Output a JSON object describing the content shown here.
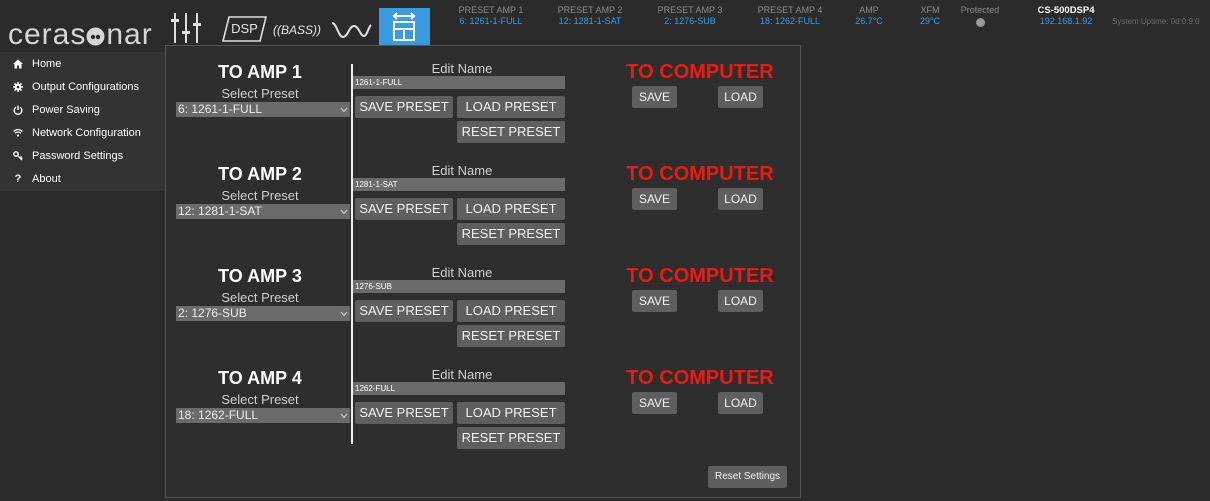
{
  "brand": {
    "logo_left": "ceras",
    "logo_right": "nar"
  },
  "toolbar": {
    "sliders_icon": "sliders-icon",
    "dsp_label": "DSP",
    "bass_label": "((BASS))",
    "wave_icon": "waveform-icon",
    "active_icon": "preset-transfer-icon"
  },
  "status": {
    "preset_amp_1": {
      "label": "PRESET AMP 1",
      "value": "6: 1261-1-FULL"
    },
    "preset_amp_2": {
      "label": "PRESET AMP 2",
      "value": "12: 1281-1-SAT"
    },
    "preset_amp_3": {
      "label": "PRESET AMP 3",
      "value": "2: 1276-SUB"
    },
    "preset_amp_4": {
      "label": "PRESET AMP 4",
      "value": "18: 1262-FULL"
    },
    "amp_temp": {
      "label": "AMP",
      "value": "26.7°C"
    },
    "xfm_temp": {
      "label": "XFM",
      "value": "29°C"
    },
    "protected": {
      "label": "Protected"
    },
    "device": {
      "model": "CS-500DSP4",
      "ip": "192.168.1.92"
    },
    "uptime": "System Uptime: 0d:0:9:0"
  },
  "sidebar": {
    "items": [
      {
        "label": "Home",
        "icon": "home-icon"
      },
      {
        "label": "Output Configurations",
        "icon": "gear-icon"
      },
      {
        "label": "Power Saving",
        "icon": "power-icon"
      },
      {
        "label": "Network Configuration",
        "icon": "wifi-icon"
      },
      {
        "label": "Password Settings",
        "icon": "key-icon"
      },
      {
        "label": "About",
        "icon": "question-icon",
        "icon_glyph": "?"
      }
    ]
  },
  "amps": [
    {
      "title": "TO AMP 1",
      "select_label": "Select Preset",
      "selected_preset": "6: 1261-1-FULL",
      "edit_name_label": "Edit Name",
      "name_value": "1261-1-FULL",
      "save_preset_label": "SAVE PRESET",
      "load_preset_label": "LOAD PRESET",
      "reset_preset_label": "RESET PRESET",
      "computer_title": "TO COMPUTER",
      "save_label": "SAVE",
      "load_label": "LOAD"
    },
    {
      "title": "TO AMP 2",
      "select_label": "Select Preset",
      "selected_preset": "12: 1281-1-SAT",
      "edit_name_label": "Edit Name",
      "name_value": "1281-1-SAT",
      "save_preset_label": "SAVE PRESET",
      "load_preset_label": "LOAD PRESET",
      "reset_preset_label": "RESET PRESET",
      "computer_title": "TO COMPUTER",
      "save_label": "SAVE",
      "load_label": "LOAD"
    },
    {
      "title": "TO AMP 3",
      "select_label": "Select Preset",
      "selected_preset": "2: 1276-SUB",
      "edit_name_label": "Edit Name",
      "name_value": "1276-SUB",
      "save_preset_label": "SAVE PRESET",
      "load_preset_label": "LOAD PRESET",
      "reset_preset_label": "RESET PRESET",
      "computer_title": "TO COMPUTER",
      "save_label": "SAVE",
      "load_label": "LOAD"
    },
    {
      "title": "TO AMP 4",
      "select_label": "Select Preset",
      "selected_preset": "18: 1262-FULL",
      "edit_name_label": "Edit Name",
      "name_value": "1262-FULL",
      "save_preset_label": "SAVE PRESET",
      "load_preset_label": "LOAD PRESET",
      "reset_preset_label": "RESET PRESET",
      "computer_title": "TO COMPUTER",
      "save_label": "SAVE",
      "load_label": "LOAD"
    }
  ],
  "footer": {
    "reset_settings_label": "Reset Settings"
  },
  "colors": {
    "page_bg": "#2b2b2b",
    "sidebar_bg": "#333333",
    "panel_bg": "#2e2e2e",
    "accent_blue": "#3b9be0",
    "warning_red": "#ee1a12",
    "control_gray": "#6b6b6b",
    "button_gray": "#5f5f5f",
    "status_gray": "#8c8c8c",
    "protected_indicator": "#9a9a9a"
  }
}
